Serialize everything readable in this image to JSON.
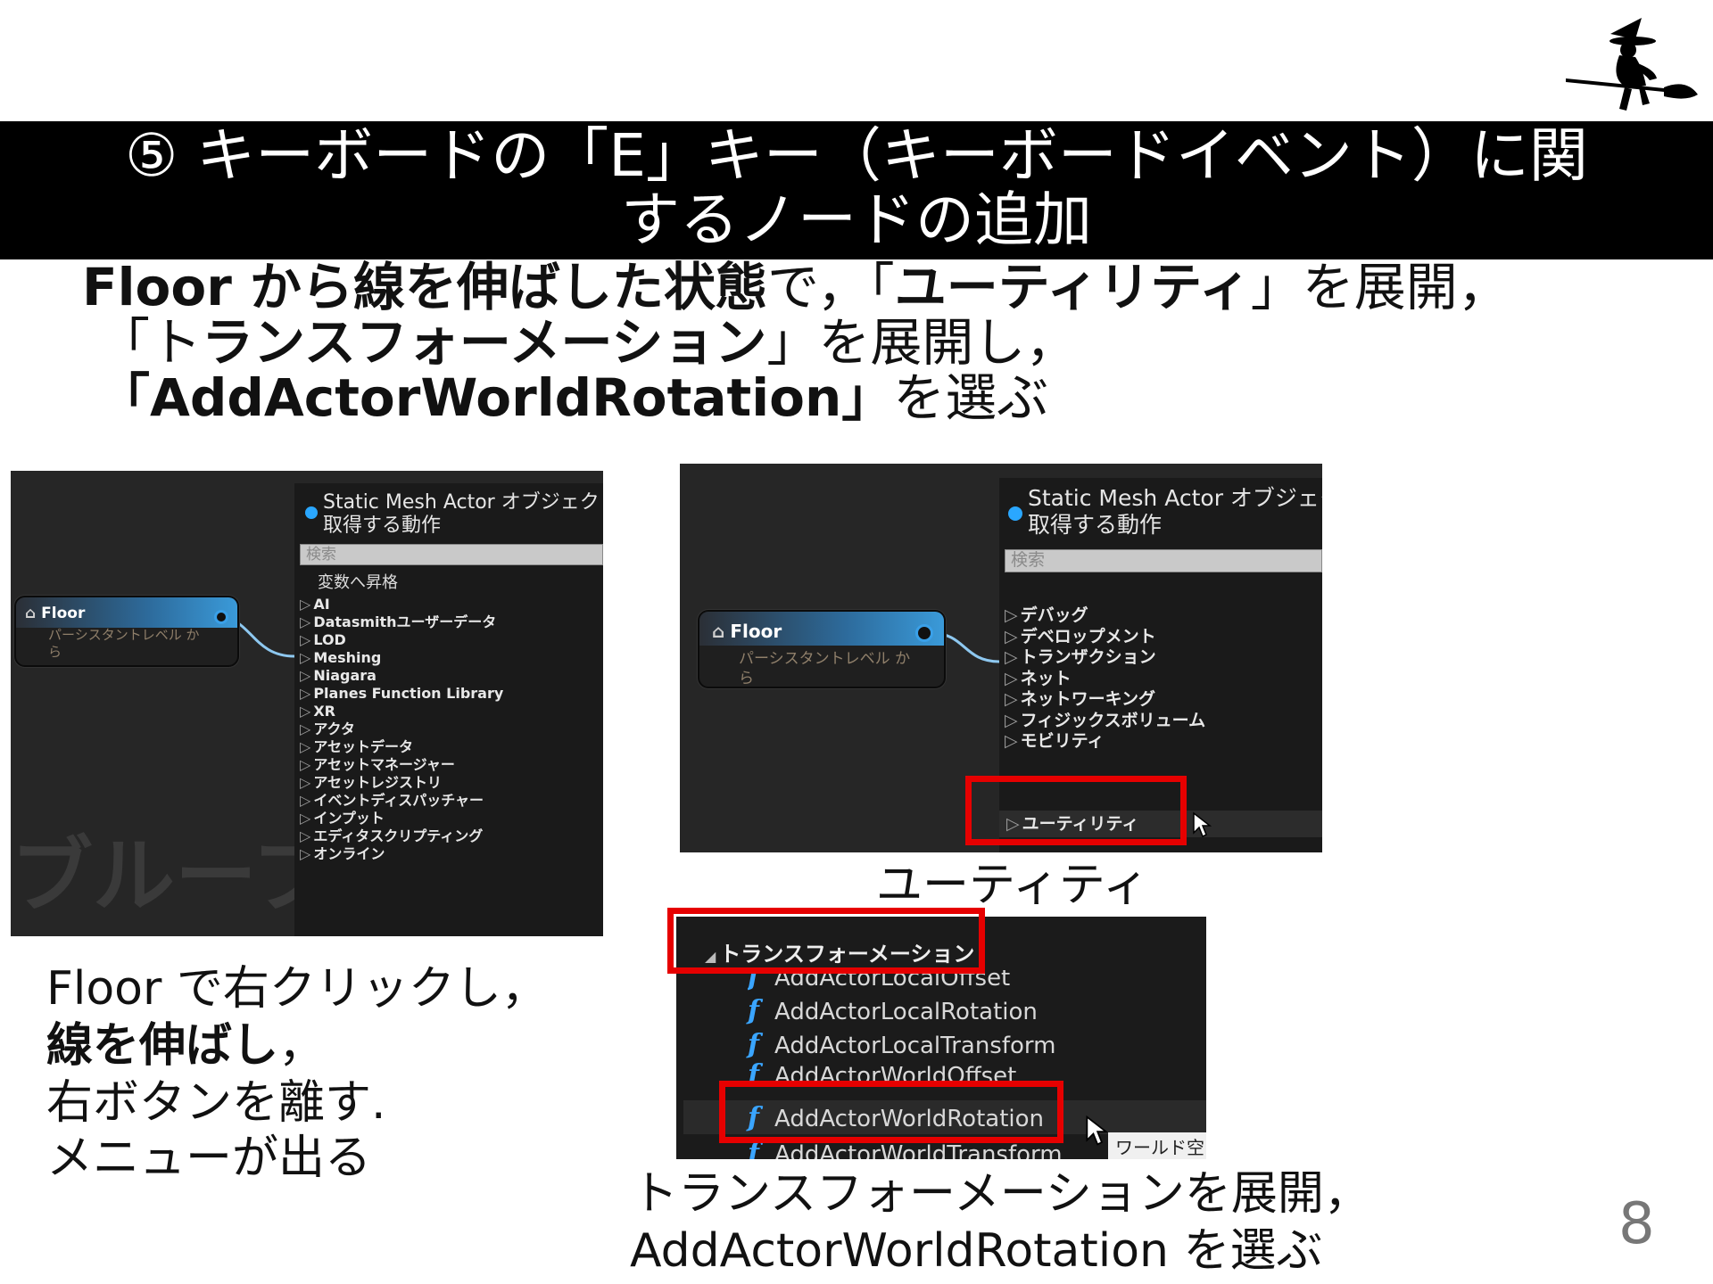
{
  "title": {
    "line1": "⑤ キーボードの「E」キー（キーボードイベント）に関",
    "line2": "するノードの追加"
  },
  "instruction": {
    "l1_bold": "Floor から線を伸ばした状態",
    "l1_mid": "で，「",
    "l1_bold2": "ユーティリティ",
    "l1_end": "」を展開，",
    "l2_start": "「ト",
    "l2_bold": "ランスフォーメーション",
    "l2_end": "」を展開し，",
    "l3_bold": "「AddActorWorldRotation」",
    "l3_end": "を選ぶ"
  },
  "shot1": {
    "menu_title_1": "Static Mesh Actor オブジェクト参",
    "menu_title_2": "取得する動作",
    "search_placeholder": "検索",
    "first_item": "変数へ昇格",
    "items": [
      "AI",
      "Datasmithユーザーデータ",
      "LOD",
      "Meshing",
      "Niagara",
      "Planes Function Library",
      "XR",
      "アクタ",
      "アセットデータ",
      "アセットマネージャー",
      "アセットレジストリ",
      "イベントディスパッチャー",
      "インプット",
      "エディタスクリプティング",
      "オンライン"
    ],
    "node_title": "Floor",
    "node_sub_1": "パーシスタントレベル か",
    "node_sub_2": "ら",
    "watermark": "ブループ"
  },
  "shot2": {
    "menu_title_1": "Static Mesh Actor オブジェク",
    "menu_title_2": "取得する動作",
    "search_placeholder": "検索",
    "items": [
      "デバッグ",
      "デベロップメント",
      "トランザクション",
      "ネット",
      "ネットワーキング",
      "フィジックスボリューム",
      "モビリティ"
    ],
    "highlight_item": "ユーティリティ",
    "node_title": "Floor",
    "node_sub_1": "パーシスタントレベル か",
    "node_sub_2": "ら",
    "caption": "ユーティティ"
  },
  "shot3": {
    "header": "トランスフォーメーション",
    "items": [
      "AddActorLocalOffset",
      "AddActorLocalRotation",
      "AddActorLocalTransform",
      "AddActorWorldOffset"
    ],
    "highlight_item": "AddActorWorldRotation",
    "last_item": "AddActorWorldTransform",
    "tooltip": "ワールド空"
  },
  "left_caption": {
    "l1": "Floor で右クリックし，",
    "l2_bold": "線を伸ばし",
    "l2_end": "，",
    "l3": "右ボタンを離す.",
    "l4": "メニューが出る"
  },
  "bottom_caption": {
    "l1": "トランスフォーメーションを展開，",
    "l2": "AddActorWorldRotation を選ぶ"
  },
  "page_number": "8",
  "colors": {
    "highlight": "#e60000",
    "accent": "#2aa7ff",
    "panel": "#262626"
  }
}
